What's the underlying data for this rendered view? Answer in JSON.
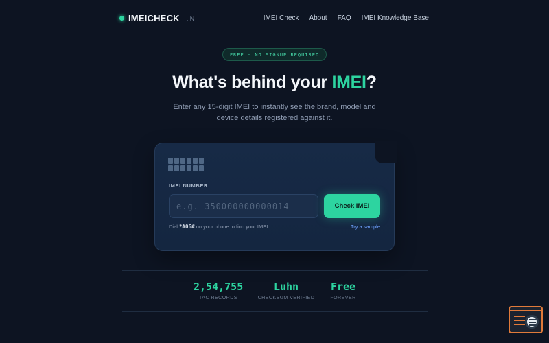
{
  "nav": {
    "logo_text": "IMEICHECK",
    "logo_tld": ".IN",
    "links": [
      "IMEI Check",
      "About",
      "FAQ",
      "IMEI Knowledge Base"
    ]
  },
  "hero": {
    "badge": "FREE · NO SIGNUP REQUIRED",
    "headline_prefix": "What's behind your ",
    "headline_accent": "IMEI",
    "headline_suffix": "?",
    "subtitle": "Enter any 15-digit IMEI to instantly see the brand, model and device details registered against it."
  },
  "form": {
    "field_label": "IMEI NUMBER",
    "input_value": "",
    "input_placeholder": "e.g. 350000000000014",
    "submit_label": "Check IMEI",
    "hint_prefix": "Dial ",
    "hint_code": "*#06#",
    "hint_suffix": " on your phone to find your IMEI",
    "sample_link": "Try a sample"
  },
  "stats": [
    {
      "value": "2,54,755",
      "label": "TAC RECORDS"
    },
    {
      "value": "Luhn",
      "label": "CHECKSUM VERIFIED"
    },
    {
      "value": "Free",
      "label": "FOREVER"
    }
  ],
  "colors": {
    "background": "#0d1422",
    "accent": "#2dd4a0",
    "card": "#172a46",
    "link": "#6fa3ff"
  },
  "icons": {
    "logo": "status-dot-icon",
    "digits": "digit-grid-icon",
    "widget": "terminal-search-icon"
  }
}
